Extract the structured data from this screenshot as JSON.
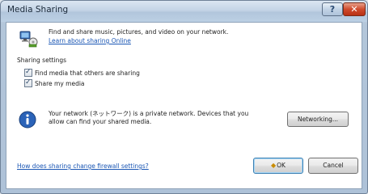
{
  "window": {
    "title": "Media Sharing",
    "help_glyph": "?",
    "close_glyph": "✕"
  },
  "intro": {
    "text": "Find and share music, pictures, and video on your network.",
    "learn_link": "Learn about sharing Online"
  },
  "settings": {
    "heading": "Sharing settings",
    "options": [
      {
        "label": "Find media that others are sharing",
        "checked": true
      },
      {
        "label": "Share my media",
        "checked": true
      }
    ]
  },
  "network_info": {
    "text": "Your network (ネットワーク) is a private network. Devices that you allow can find your shared media.",
    "networking_button": "Networking..."
  },
  "footer": {
    "firewall_link": "How does sharing change firewall settings?",
    "ok_label": "OK",
    "cancel_label": "Cancel"
  },
  "icons": {
    "share": "media-share-icon",
    "info": "info-icon",
    "ok_shield": "uac-shield-icon"
  },
  "colors": {
    "link": "#1a56b4",
    "info_blue": "#2b63b8"
  }
}
